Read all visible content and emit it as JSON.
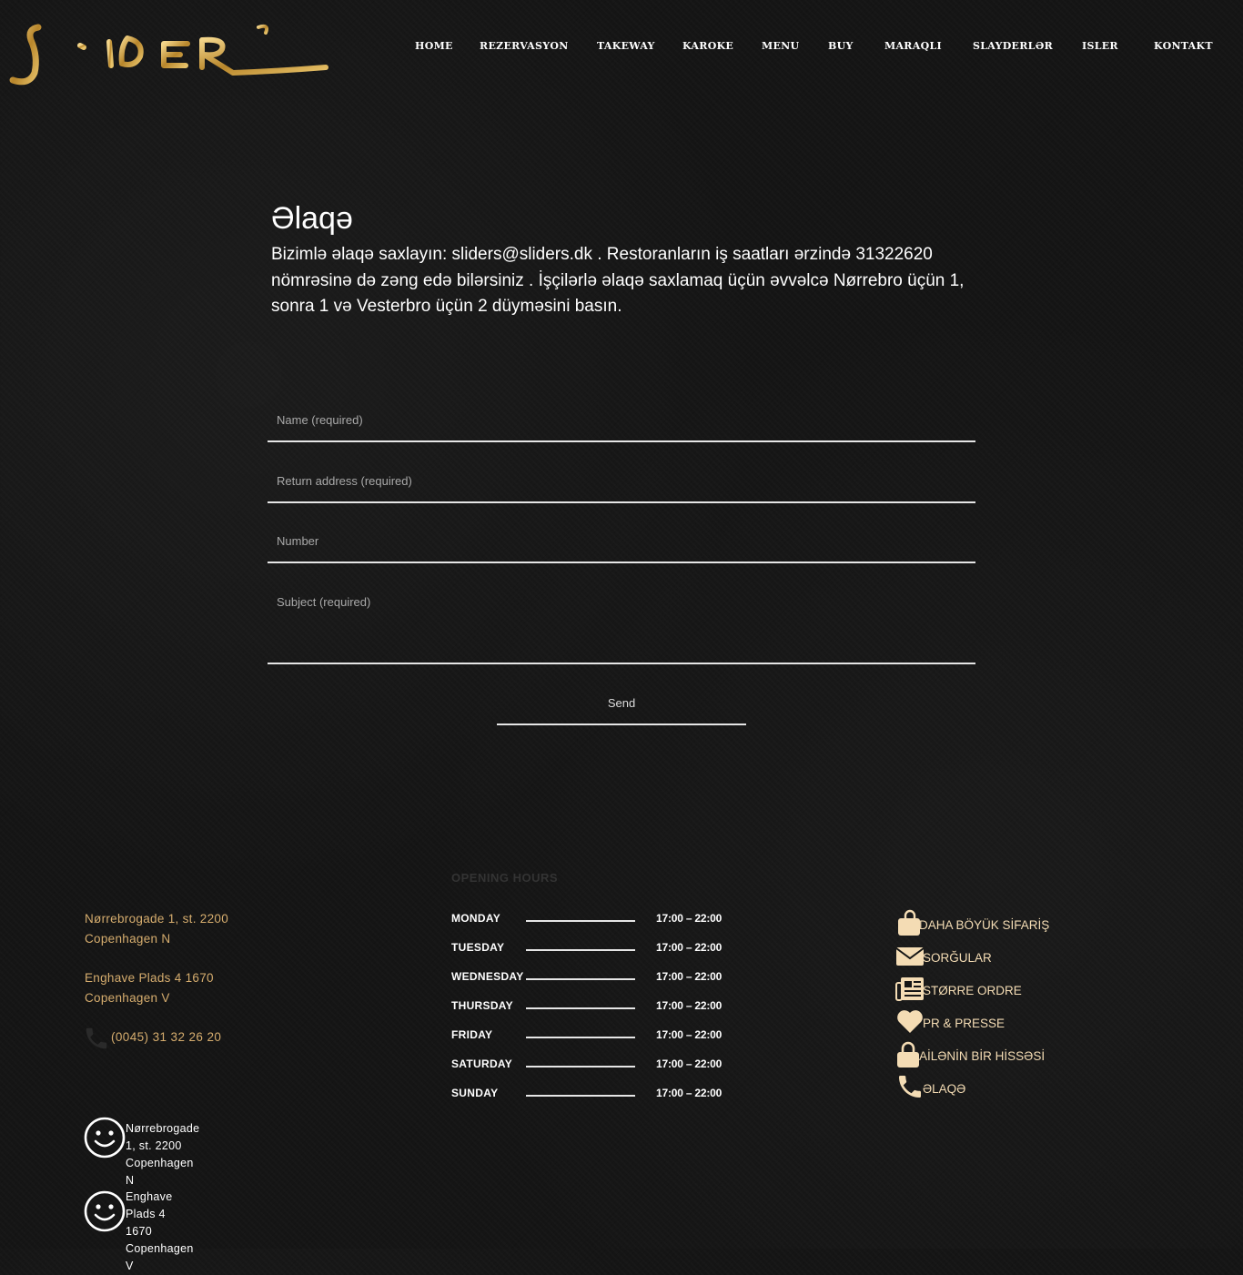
{
  "header": {
    "logo_alt": "Sliders",
    "nav": [
      "HOME",
      "REZERVASYON",
      "TAKEWAY",
      "KAROKE",
      "MENU",
      "BUY",
      "MARAQLI",
      "SLAYDERLƏR",
      "ISLER",
      "KONTAKT"
    ]
  },
  "main": {
    "title": "Əlaqə",
    "intro": "Bizimlə əlaqə saxlayın: sliders@sliders.dk . Restoranların iş saatları ərzində 31322620 nömrəsinə də zəng edə bilərsiniz . İşçilərlə əlaqə saxlamaq üçün əvvəlcə Nørrebro üçün 1, sonra 1 və Vesterbro üçün 2 düyməsini basın.",
    "form": {
      "name_placeholder": "Name (required)",
      "email_placeholder": "Return address (required)",
      "number_placeholder": "Number",
      "subject_placeholder": "Subject (required)",
      "send_label": "Send"
    }
  },
  "footer": {
    "address1_line1": "Nørrebrogade 1, st. 2200",
    "address1_line2": "Copenhagen N",
    "address2_line1": "Enghave Plads 4 1670",
    "address2_line2": "Copenhagen V",
    "phone": "(0045) 31 32 26 20",
    "hours_title": "OPENING HOURS",
    "hours": [
      {
        "day": "MONDAY",
        "time": "17:00 – 22:00"
      },
      {
        "day": "TUESDAY",
        "time": "17:00 – 22:00"
      },
      {
        "day": "WEDNESDAY",
        "time": "17:00 – 22:00"
      },
      {
        "day": "THURSDAY",
        "time": "17:00 – 22:00"
      },
      {
        "day": "FRIDAY",
        "time": "17:00 – 22:00"
      },
      {
        "day": "SATURDAY",
        "time": "17:00 – 22:00"
      },
      {
        "day": "SUNDAY",
        "time": "17:00 – 22:00"
      }
    ],
    "links": [
      {
        "label": "DAHA BÖYÜK SİFARİŞ",
        "icon": "shopping-bag-icon"
      },
      {
        "label": "SORĞULAR",
        "icon": "envelope-icon"
      },
      {
        "label": "STØRRE ORDRE",
        "icon": "newspaper-icon"
      },
      {
        "label": "PR & PRESSE",
        "icon": "heart-icon"
      },
      {
        "label": "AİLƏNİN BİR HİSSƏSİ",
        "icon": "lock-icon"
      },
      {
        "label": "ƏLAQƏ",
        "icon": "phone-icon"
      }
    ],
    "branches": [
      {
        "line1": "Nørrebrogade 1, st. 2200",
        "line2": "Copenhagen N"
      },
      {
        "line1": "Enghave Plads 4 1670",
        "line2": "Copenhagen V"
      }
    ]
  },
  "colors": {
    "gold": "#d6ad6e",
    "link_gold": "#f4dcb4",
    "background": "#151515"
  }
}
